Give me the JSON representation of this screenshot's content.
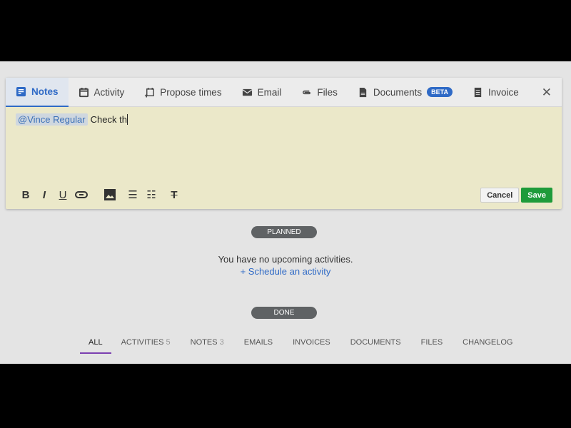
{
  "tabs": [
    {
      "label": "Notes",
      "icon": "note-icon"
    },
    {
      "label": "Activity",
      "icon": "calendar-icon"
    },
    {
      "label": "Propose times",
      "icon": "calendar-plus-icon"
    },
    {
      "label": "Email",
      "icon": "envelope-icon"
    },
    {
      "label": "Files",
      "icon": "paperclip-icon"
    },
    {
      "label": "Documents",
      "icon": "document-icon",
      "badge": "BETA"
    },
    {
      "label": "Invoice",
      "icon": "invoice-icon"
    }
  ],
  "editor": {
    "mention": "@Vince Regular",
    "text": "Check th"
  },
  "toolbar": {
    "bold": "B",
    "italic": "I",
    "underline": "U"
  },
  "actions": {
    "cancel": "Cancel",
    "save": "Save"
  },
  "planned": "PLANNED",
  "empty": "You have no upcoming activities.",
  "schedule": "+ Schedule an activity",
  "done": "DONE",
  "filters": [
    {
      "label": "ALL"
    },
    {
      "label": "ACTIVITIES",
      "count": "5"
    },
    {
      "label": "NOTES",
      "count": "3"
    },
    {
      "label": "EMAILS"
    },
    {
      "label": "INVOICES"
    },
    {
      "label": "DOCUMENTS"
    },
    {
      "label": "FILES"
    },
    {
      "label": "CHANGELOG"
    }
  ],
  "colors": {
    "accent": "#2f6ac6",
    "save": "#1e9b3a",
    "editor_bg": "#ebe8c9",
    "active_filter": "#7b3fb0"
  }
}
